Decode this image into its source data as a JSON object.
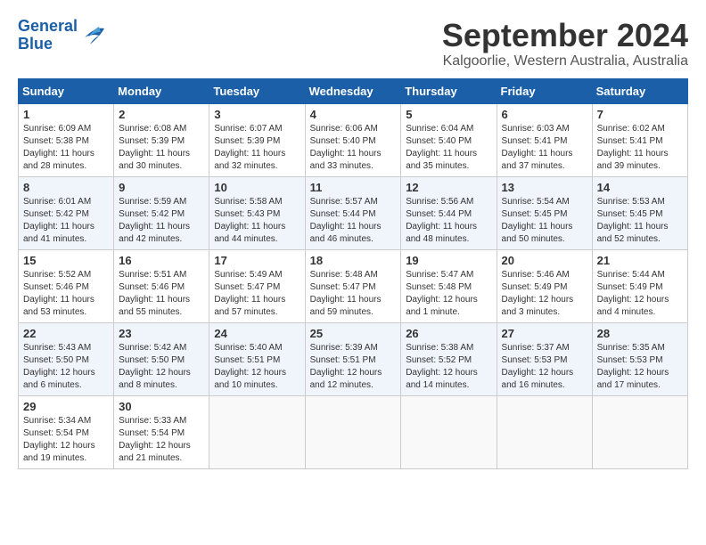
{
  "header": {
    "logo_line1": "General",
    "logo_line2": "Blue",
    "month_year": "September 2024",
    "location": "Kalgoorlie, Western Australia, Australia"
  },
  "days_of_week": [
    "Sunday",
    "Monday",
    "Tuesday",
    "Wednesday",
    "Thursday",
    "Friday",
    "Saturday"
  ],
  "weeks": [
    [
      {
        "day": "1",
        "info": "Sunrise: 6:09 AM\nSunset: 5:38 PM\nDaylight: 11 hours\nand 28 minutes."
      },
      {
        "day": "2",
        "info": "Sunrise: 6:08 AM\nSunset: 5:39 PM\nDaylight: 11 hours\nand 30 minutes."
      },
      {
        "day": "3",
        "info": "Sunrise: 6:07 AM\nSunset: 5:39 PM\nDaylight: 11 hours\nand 32 minutes."
      },
      {
        "day": "4",
        "info": "Sunrise: 6:06 AM\nSunset: 5:40 PM\nDaylight: 11 hours\nand 33 minutes."
      },
      {
        "day": "5",
        "info": "Sunrise: 6:04 AM\nSunset: 5:40 PM\nDaylight: 11 hours\nand 35 minutes."
      },
      {
        "day": "6",
        "info": "Sunrise: 6:03 AM\nSunset: 5:41 PM\nDaylight: 11 hours\nand 37 minutes."
      },
      {
        "day": "7",
        "info": "Sunrise: 6:02 AM\nSunset: 5:41 PM\nDaylight: 11 hours\nand 39 minutes."
      }
    ],
    [
      {
        "day": "8",
        "info": "Sunrise: 6:01 AM\nSunset: 5:42 PM\nDaylight: 11 hours\nand 41 minutes."
      },
      {
        "day": "9",
        "info": "Sunrise: 5:59 AM\nSunset: 5:42 PM\nDaylight: 11 hours\nand 42 minutes."
      },
      {
        "day": "10",
        "info": "Sunrise: 5:58 AM\nSunset: 5:43 PM\nDaylight: 11 hours\nand 44 minutes."
      },
      {
        "day": "11",
        "info": "Sunrise: 5:57 AM\nSunset: 5:44 PM\nDaylight: 11 hours\nand 46 minutes."
      },
      {
        "day": "12",
        "info": "Sunrise: 5:56 AM\nSunset: 5:44 PM\nDaylight: 11 hours\nand 48 minutes."
      },
      {
        "day": "13",
        "info": "Sunrise: 5:54 AM\nSunset: 5:45 PM\nDaylight: 11 hours\nand 50 minutes."
      },
      {
        "day": "14",
        "info": "Sunrise: 5:53 AM\nSunset: 5:45 PM\nDaylight: 11 hours\nand 52 minutes."
      }
    ],
    [
      {
        "day": "15",
        "info": "Sunrise: 5:52 AM\nSunset: 5:46 PM\nDaylight: 11 hours\nand 53 minutes."
      },
      {
        "day": "16",
        "info": "Sunrise: 5:51 AM\nSunset: 5:46 PM\nDaylight: 11 hours\nand 55 minutes."
      },
      {
        "day": "17",
        "info": "Sunrise: 5:49 AM\nSunset: 5:47 PM\nDaylight: 11 hours\nand 57 minutes."
      },
      {
        "day": "18",
        "info": "Sunrise: 5:48 AM\nSunset: 5:47 PM\nDaylight: 11 hours\nand 59 minutes."
      },
      {
        "day": "19",
        "info": "Sunrise: 5:47 AM\nSunset: 5:48 PM\nDaylight: 12 hours\nand 1 minute."
      },
      {
        "day": "20",
        "info": "Sunrise: 5:46 AM\nSunset: 5:49 PM\nDaylight: 12 hours\nand 3 minutes."
      },
      {
        "day": "21",
        "info": "Sunrise: 5:44 AM\nSunset: 5:49 PM\nDaylight: 12 hours\nand 4 minutes."
      }
    ],
    [
      {
        "day": "22",
        "info": "Sunrise: 5:43 AM\nSunset: 5:50 PM\nDaylight: 12 hours\nand 6 minutes."
      },
      {
        "day": "23",
        "info": "Sunrise: 5:42 AM\nSunset: 5:50 PM\nDaylight: 12 hours\nand 8 minutes."
      },
      {
        "day": "24",
        "info": "Sunrise: 5:40 AM\nSunset: 5:51 PM\nDaylight: 12 hours\nand 10 minutes."
      },
      {
        "day": "25",
        "info": "Sunrise: 5:39 AM\nSunset: 5:51 PM\nDaylight: 12 hours\nand 12 minutes."
      },
      {
        "day": "26",
        "info": "Sunrise: 5:38 AM\nSunset: 5:52 PM\nDaylight: 12 hours\nand 14 minutes."
      },
      {
        "day": "27",
        "info": "Sunrise: 5:37 AM\nSunset: 5:53 PM\nDaylight: 12 hours\nand 16 minutes."
      },
      {
        "day": "28",
        "info": "Sunrise: 5:35 AM\nSunset: 5:53 PM\nDaylight: 12 hours\nand 17 minutes."
      }
    ],
    [
      {
        "day": "29",
        "info": "Sunrise: 5:34 AM\nSunset: 5:54 PM\nDaylight: 12 hours\nand 19 minutes."
      },
      {
        "day": "30",
        "info": "Sunrise: 5:33 AM\nSunset: 5:54 PM\nDaylight: 12 hours\nand 21 minutes."
      },
      {
        "day": "",
        "info": ""
      },
      {
        "day": "",
        "info": ""
      },
      {
        "day": "",
        "info": ""
      },
      {
        "day": "",
        "info": ""
      },
      {
        "day": "",
        "info": ""
      }
    ]
  ]
}
